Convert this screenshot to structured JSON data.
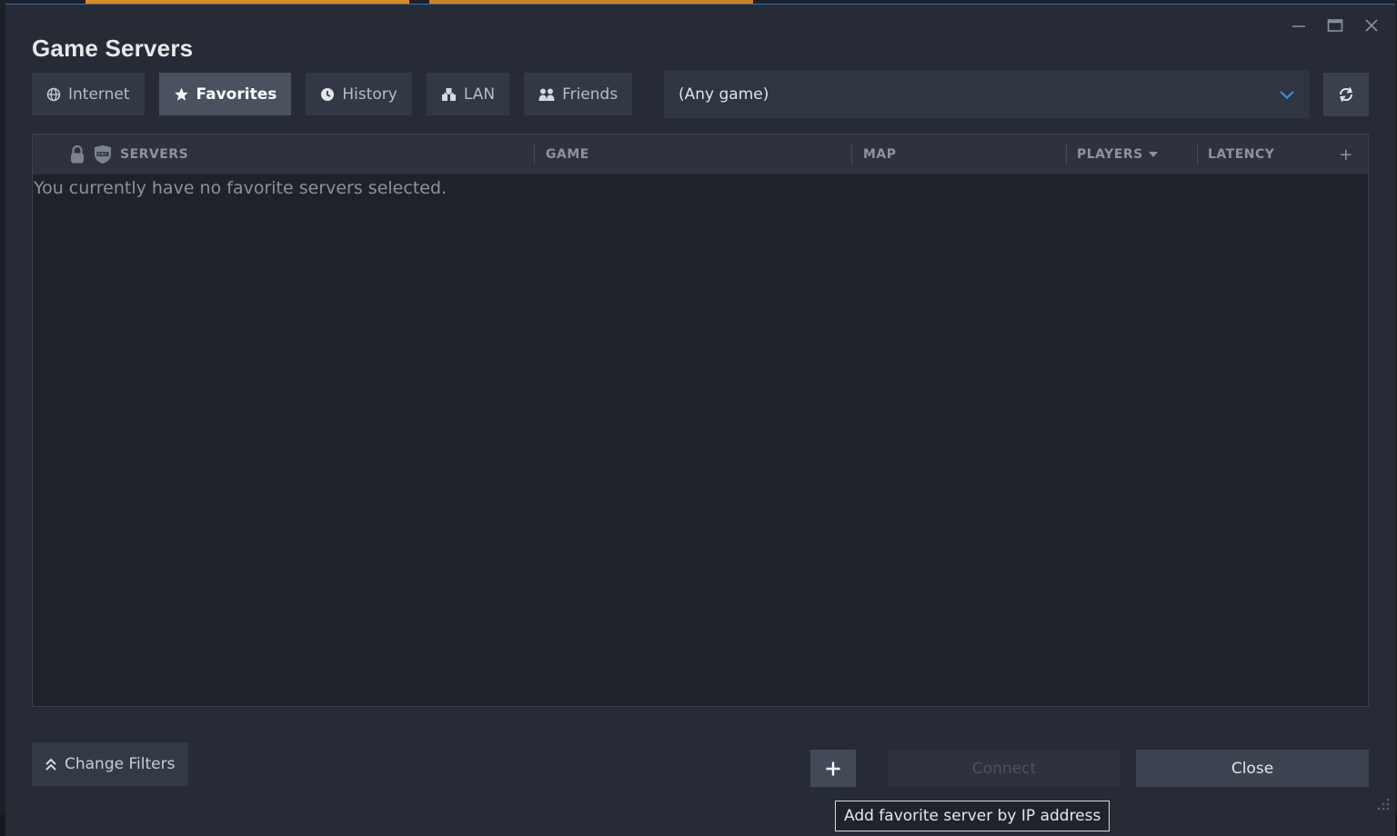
{
  "window": {
    "title": "Game Servers"
  },
  "tabs": [
    {
      "label": "Internet",
      "icon": "globe-icon",
      "active": false
    },
    {
      "label": "Favorites",
      "icon": "star-icon",
      "active": true
    },
    {
      "label": "History",
      "icon": "clock-icon",
      "active": false
    },
    {
      "label": "LAN",
      "icon": "lan-icon",
      "active": false
    },
    {
      "label": "Friends",
      "icon": "friends-icon",
      "active": false
    }
  ],
  "game_filter": {
    "selected": "(Any game)"
  },
  "table": {
    "columns": {
      "servers": "SERVERS",
      "game": "GAME",
      "map": "MAP",
      "players": "PLAYERS",
      "latency": "LATENCY",
      "add": "+"
    },
    "empty_message": "You currently have no favorite servers selected."
  },
  "footer": {
    "change_filters": "Change Filters",
    "connect": "Connect",
    "close": "Close",
    "add_tooltip": "Add favorite server by IP address"
  },
  "colors": {
    "window_bg": "#262b35",
    "accent_blue": "#3d8ee0",
    "tab_active": "#4a5260",
    "tab_inactive": "#323844"
  }
}
